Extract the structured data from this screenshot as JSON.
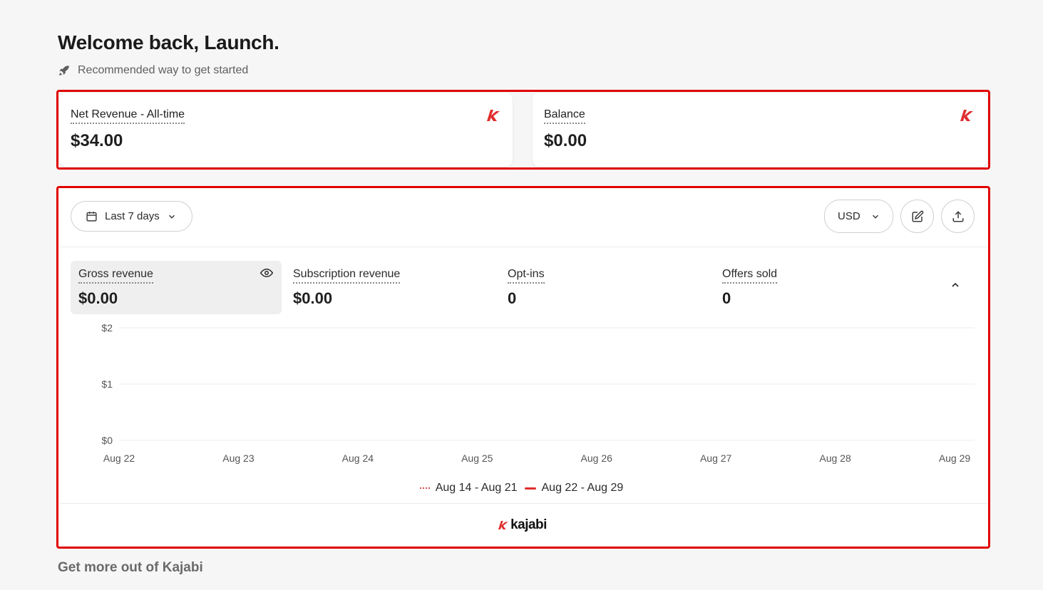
{
  "header": {
    "title": "Welcome back, Launch.",
    "recommended": "Recommended way to get started"
  },
  "cards": {
    "net_revenue": {
      "label": "Net Revenue - All-time",
      "value": "$34.00",
      "icon": "kajabi-k-icon"
    },
    "balance": {
      "label": "Balance",
      "value": "$0.00",
      "icon": "kajabi-k-icon"
    }
  },
  "toolbar": {
    "range_label": "Last 7 days",
    "currency_label": "USD"
  },
  "metrics": [
    {
      "label": "Gross revenue",
      "value": "$0.00"
    },
    {
      "label": "Subscription revenue",
      "value": "$0.00"
    },
    {
      "label": "Opt-ins",
      "value": "0"
    },
    {
      "label": "Offers sold",
      "value": "0"
    }
  ],
  "chart_data": {
    "type": "line",
    "categories": [
      "Aug 22",
      "Aug 23",
      "Aug 24",
      "Aug 25",
      "Aug 26",
      "Aug 27",
      "Aug 28",
      "Aug 29"
    ],
    "y_ticks": [
      "$0",
      "$1",
      "$2"
    ],
    "ylim": [
      0,
      2
    ],
    "series": [
      {
        "name": "Aug 14 - Aug 21",
        "values": [
          0,
          0,
          0,
          0,
          0,
          0,
          0,
          0
        ],
        "style": "dotted",
        "color": "#e34b4b"
      },
      {
        "name": "Aug 22 - Aug 29",
        "values": [
          0,
          0,
          0,
          0,
          0,
          0,
          0,
          0
        ],
        "style": "solid",
        "color": "#e02e2e"
      }
    ],
    "grid": true,
    "legend": "bottom-center"
  },
  "brand": {
    "word": "kajabi",
    "accent": "#e02e2e"
  },
  "footer": {
    "more_title": "Get more out of Kajabi"
  }
}
